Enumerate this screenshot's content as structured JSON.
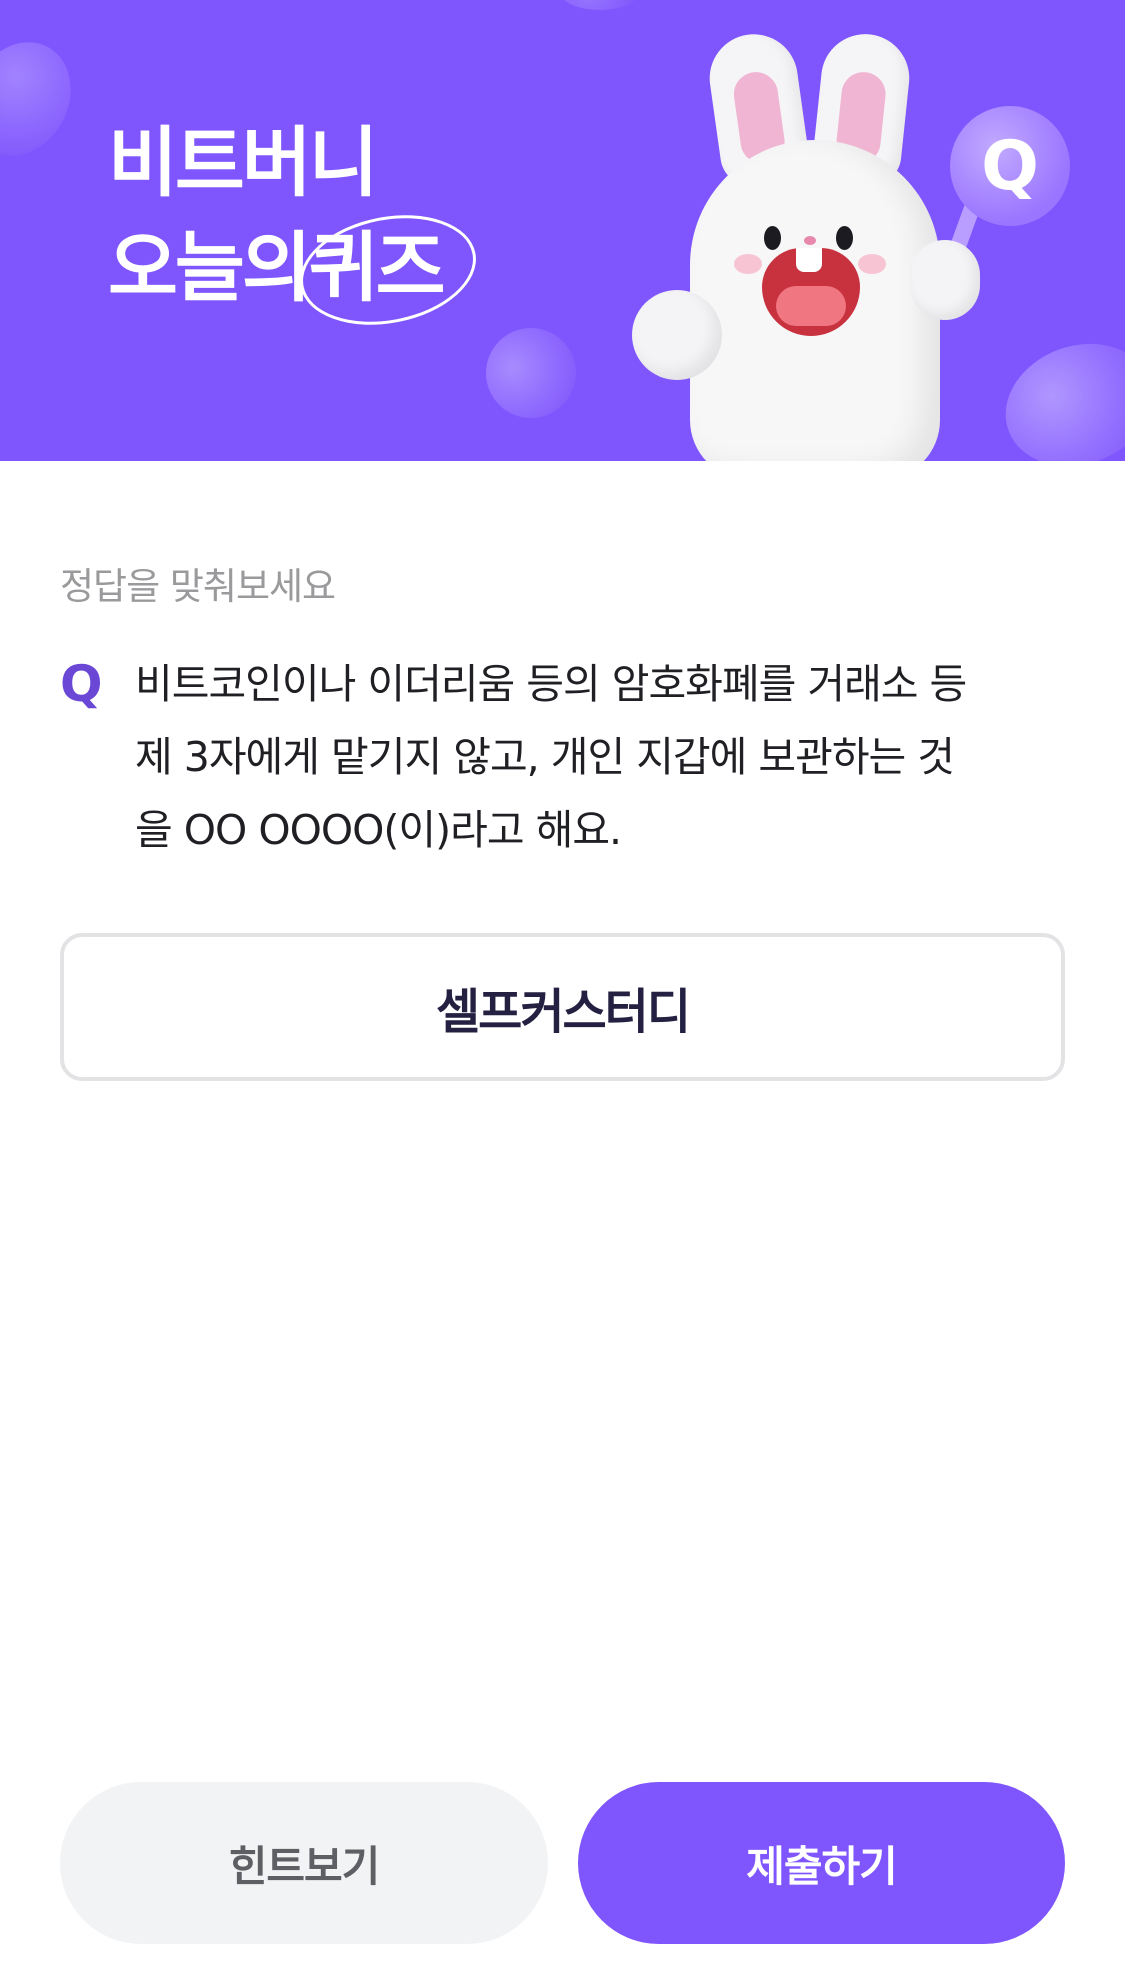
{
  "banner": {
    "title_line1": "비트버니",
    "title_line2_prefix": "오늘의",
    "title_line2_highlight": "퀴즈",
    "sign_letter": "Q",
    "background_color": "#7f55fd"
  },
  "quiz": {
    "instruction": "정답을 맞춰보세요",
    "q_mark": "Q",
    "question_lines": [
      "비트코인이나 이더리움 등의 암호화폐를 거래소 등",
      "제 3자에게 맡기지 않고, 개인 지갑에 보관하는 것",
      "을 OO OOOO(이)라고 해요."
    ],
    "answer": "셀프커스터디"
  },
  "actions": {
    "hint_label": "힌트보기",
    "submit_label": "제출하기"
  },
  "colors": {
    "accent": "#7f55fd",
    "q_mark": "#6b47d6",
    "hint_bg": "#f2f3f5"
  }
}
